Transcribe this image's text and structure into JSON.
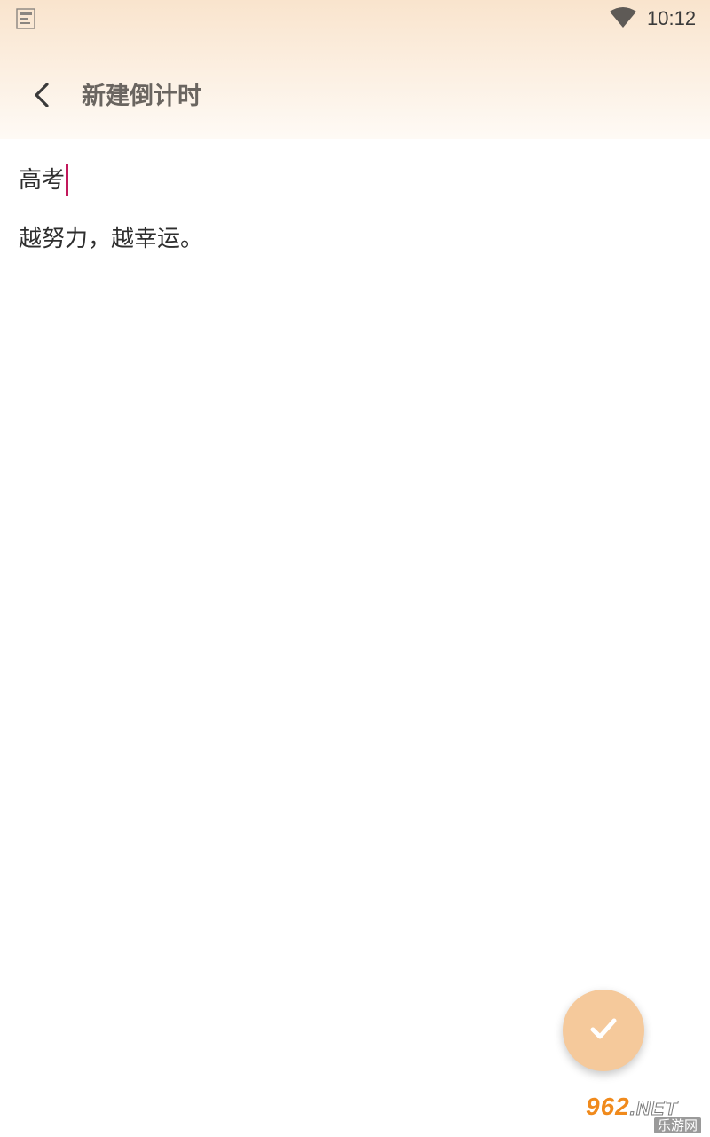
{
  "status_bar": {
    "time": "10:12",
    "icons": [
      "notification-icon",
      "wifi-icon"
    ]
  },
  "header": {
    "back_icon": "chevron-left-icon",
    "title": "新建倒计时"
  },
  "form": {
    "title_value": "高考",
    "note_value": "越努力，越幸运。"
  },
  "fab": {
    "icon": "check-icon"
  },
  "watermark": {
    "number": "962",
    "suffix": ".NET",
    "site_name": "乐游网"
  },
  "colors": {
    "header_gradient_top": "#f9e4cd",
    "caret": "#c2185b",
    "fab_background": "#f5c99b",
    "title_text": "#6a6560"
  }
}
